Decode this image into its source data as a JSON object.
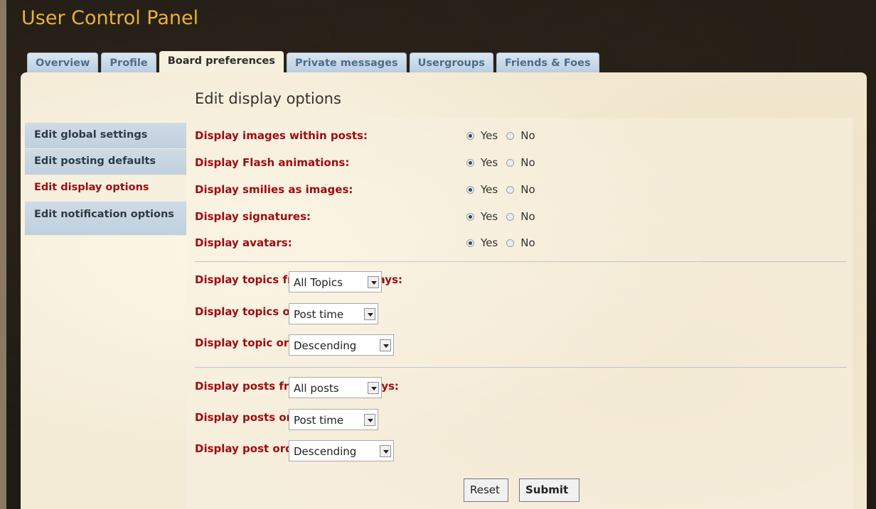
{
  "app": {
    "title": "User Control Panel"
  },
  "tabs": [
    {
      "label": "Overview"
    },
    {
      "label": "Profile"
    },
    {
      "label": "Board preferences"
    },
    {
      "label": "Private messages"
    },
    {
      "label": "Usergroups"
    },
    {
      "label": "Friends & Foes"
    }
  ],
  "active_tab": "Board preferences",
  "sidebar": {
    "items": [
      {
        "label": "Edit global settings"
      },
      {
        "label": "Edit posting defaults"
      },
      {
        "label": "Edit display options"
      },
      {
        "label": "Edit notification options"
      }
    ],
    "active": "Edit display options"
  },
  "section_title": "Edit display options",
  "radio_options": {
    "yes": "Yes",
    "no": "No"
  },
  "radio_rows": [
    {
      "label": "Display images within posts:",
      "selected": "Yes"
    },
    {
      "label": "Display Flash animations:",
      "selected": "Yes"
    },
    {
      "label": "Display smilies as images:",
      "selected": "Yes"
    },
    {
      "label": "Display signatures:",
      "selected": "Yes"
    },
    {
      "label": "Display avatars:",
      "selected": "Yes"
    }
  ],
  "topic_selects": [
    {
      "label": "Display topics from previous days:",
      "value": "All Topics"
    },
    {
      "label": "Display topics ordering by:",
      "value": "Post time"
    },
    {
      "label": "Display topic order direction:",
      "value": "Descending"
    }
  ],
  "post_selects": [
    {
      "label": "Display posts from previous days:",
      "value": "All posts"
    },
    {
      "label": "Display posts ordering by:",
      "value": "Post time"
    },
    {
      "label": "Display post order direction:",
      "value": "Descending"
    }
  ],
  "buttons": {
    "reset": "Reset",
    "submit": "Submit"
  },
  "colors": {
    "accent": "#e8b13a",
    "label_red": "#9e0b0f",
    "tab_blue": "#4b6e8f"
  }
}
